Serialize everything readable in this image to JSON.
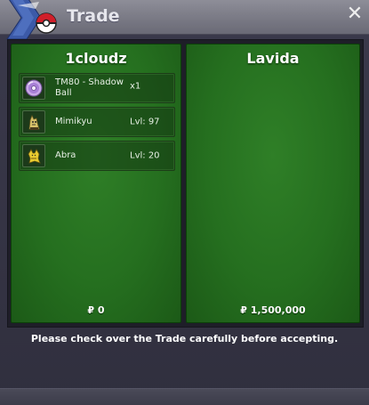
{
  "window": {
    "title": "Trade",
    "close_glyph": "✕"
  },
  "left_panel": {
    "player": "1cloudz",
    "items": [
      {
        "icon": "disc-icon",
        "name": "TM80 - Shadow Ball",
        "qty": "x1"
      },
      {
        "icon": "mimikyu-icon",
        "name": "Mimikyu",
        "level": "Lvl: 97"
      },
      {
        "icon": "abra-icon",
        "name": "Abra",
        "level": "Lvl: 20"
      }
    ],
    "money": "₽ 0"
  },
  "right_panel": {
    "player": "Lavida",
    "items": [],
    "money": "₽ 1,500,000"
  },
  "notice": "Please check over the Trade carefully before accepting.",
  "colors": {
    "panel_green": "#2a7a23",
    "titlebar": "#7d7d88",
    "window_bg": "#353444"
  }
}
